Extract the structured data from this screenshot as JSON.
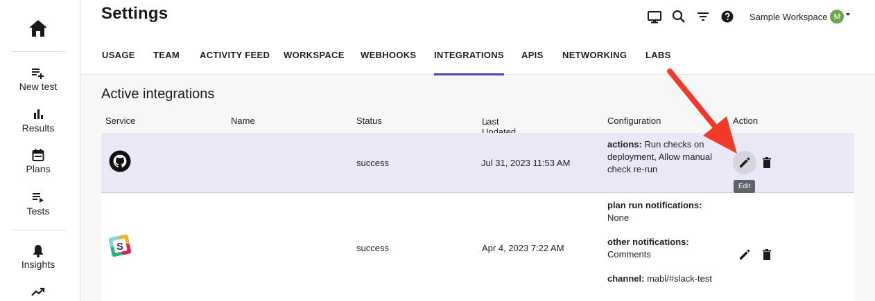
{
  "nav": {
    "items": [
      {
        "label": "New test",
        "icon": "new-test-icon"
      },
      {
        "label": "Results",
        "icon": "bar-chart-icon"
      },
      {
        "label": "Plans",
        "icon": "calendar-icon"
      },
      {
        "label": "Tests",
        "icon": "test-list-icon"
      },
      {
        "label": "Insights",
        "icon": "bell-icon"
      }
    ]
  },
  "header": {
    "title": "Settings",
    "workspace": "Sample Workspace",
    "avatar_letter": "M"
  },
  "tabs": [
    {
      "label": "USAGE"
    },
    {
      "label": "TEAM"
    },
    {
      "label": "ACTIVITY FEED"
    },
    {
      "label": "WORKSPACE"
    },
    {
      "label": "WEBHOOKS"
    },
    {
      "label": "INTEGRATIONS",
      "active": true
    },
    {
      "label": "APIS"
    },
    {
      "label": "NETWORKING"
    },
    {
      "label": "LABS"
    }
  ],
  "integrations": {
    "title": "Active integrations",
    "columns": {
      "service": "Service",
      "name": "Name",
      "status": "Status",
      "last_updated": "Last Updated",
      "sort_arrow": "↓",
      "configuration": "Configuration",
      "action": "Action"
    },
    "rows": [
      {
        "service": "github",
        "name": "",
        "status": "success",
        "last_updated": "Jul 31, 2023 11:53 AM",
        "config": [
          {
            "key": "actions:",
            "value": "Run checks on deployment, Allow manual check re-run"
          }
        ]
      },
      {
        "service": "slack",
        "name": "",
        "status": "success",
        "last_updated": "Apr 4, 2023 7:22 AM",
        "config": [
          {
            "key": "plan run notifications:",
            "value": "None"
          },
          {
            "key": "other notifications:",
            "value": "Comments"
          },
          {
            "key": "channel:",
            "value": "mabl/#slack-test"
          }
        ]
      }
    ],
    "tooltip": "Edit"
  },
  "colors": {
    "accent": "#4f3bbd",
    "selected_row": "#e9e8f6",
    "annotation_arrow": "#f23a2a",
    "avatar": "#6aa64a"
  }
}
